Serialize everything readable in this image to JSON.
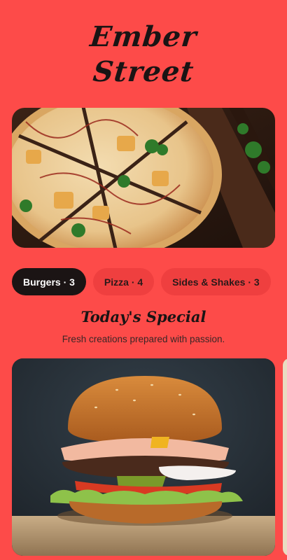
{
  "brand": {
    "line1": "Ember",
    "line2": "Street"
  },
  "hero": {
    "image": "pizza-photo"
  },
  "tabs": [
    {
      "label": "Burgers · 3",
      "active": true
    },
    {
      "label": "Pizza · 4",
      "active": false
    },
    {
      "label": "Sides & Shakes · 3",
      "active": false
    }
  ],
  "special": {
    "title": "Today's Special",
    "subtitle": "Fresh creations prepared with passion."
  },
  "cards": [
    {
      "image": "burger-photo"
    }
  ],
  "colors": {
    "background": "#fd4b49",
    "active_tab": "#1b1414",
    "inactive_tab": "#ef3f3f"
  }
}
